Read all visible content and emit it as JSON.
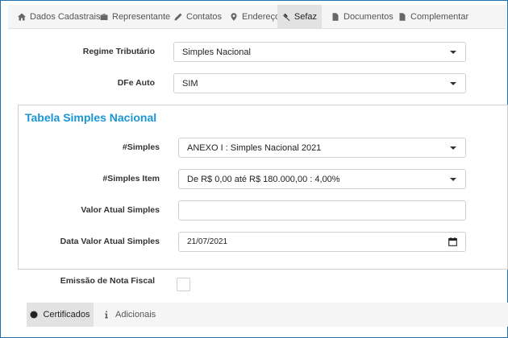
{
  "tabs": [
    {
      "label": "Dados Cadastrais",
      "icon": "home-icon"
    },
    {
      "label": "Representante",
      "icon": "briefcase-icon"
    },
    {
      "label": "Contatos",
      "icon": "pencil-icon"
    },
    {
      "label": "Endereços",
      "icon": "map-marker-icon"
    },
    {
      "label": "Sefaz",
      "icon": "gavel-icon",
      "active": true
    },
    {
      "label": "Documentos",
      "icon": "file-icon"
    },
    {
      "label": "Complementar",
      "icon": "file-icon"
    }
  ],
  "form": {
    "regime_label": "Regime Tributário",
    "regime_value": "Simples Nacional",
    "dfe_label": "DFe Auto",
    "dfe_value": "SIM"
  },
  "panel": {
    "title": "Tabela Simples Nacional",
    "simples_label": "#Simples",
    "simples_value": "ANEXO I : Simples Nacional 2021",
    "simples_item_label": "#Simples Item",
    "simples_item_value": "De R$ 0,00 até R$ 180.000,00 : 4,00%",
    "valor_label": "Valor Atual Simples",
    "valor_value": "",
    "data_label": "Data Valor Atual Simples",
    "data_value": "21/07/2021"
  },
  "emissao": {
    "label": "Emissão de Nota Fiscal",
    "checked": false
  },
  "bottom_tabs": [
    {
      "label": "Certificados",
      "icon": "certificate-icon",
      "active": true
    },
    {
      "label": "Adicionais",
      "icon": "info-icon"
    }
  ],
  "colors": {
    "accent": "#1a96d4",
    "border": "#cfcfcf",
    "tab_active_bg": "#e2e2e2",
    "tab_bg": "#f5f5f5"
  }
}
